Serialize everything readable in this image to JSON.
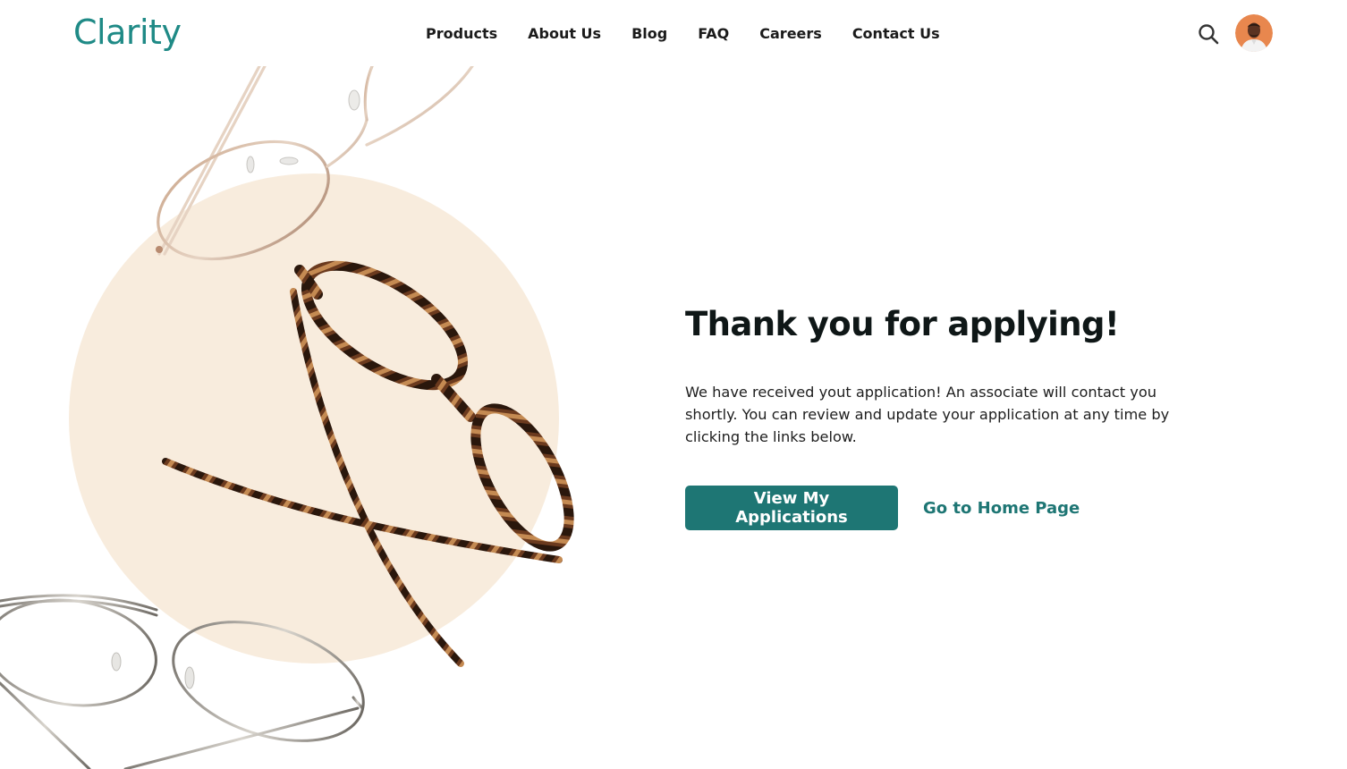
{
  "header": {
    "logo": "Clarity",
    "nav": [
      "Products",
      "About Us",
      "Blog",
      "FAQ",
      "Careers",
      "Contact Us"
    ],
    "search_icon": "search-icon",
    "avatar": "user-avatar"
  },
  "main": {
    "headline": "Thank you for applying!",
    "message": "We have received yout application! An associate will contact you shortly. You can review and update your application at any time by clicking the links below.",
    "primary_button": "View My Applications",
    "secondary_link": "Go to Home Page"
  },
  "colors": {
    "brand": "#1f8a86",
    "button": "#1e7674",
    "circle": "#f8ecdd"
  }
}
